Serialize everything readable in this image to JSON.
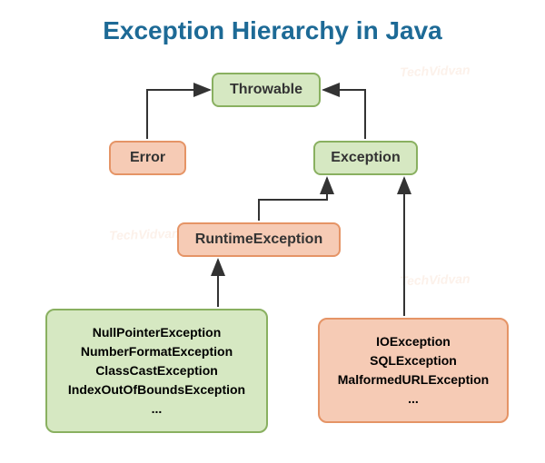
{
  "chart_data": {
    "type": "diagram",
    "title": "Exception Hierarchy in Java",
    "nodes": [
      {
        "id": "throwable",
        "label": "Throwable"
      },
      {
        "id": "error",
        "label": "Error",
        "parent": "throwable"
      },
      {
        "id": "exception",
        "label": "Exception",
        "parent": "throwable"
      },
      {
        "id": "runtime",
        "label": "RuntimeException",
        "parent": "exception"
      },
      {
        "id": "unchecked_list",
        "parent": "runtime",
        "items": [
          "NullPointerException",
          "NumberFormatException",
          "ClassCastException",
          "IndexOutOfBoundsException",
          "..."
        ]
      },
      {
        "id": "checked_list",
        "parent": "exception",
        "items": [
          "IOException",
          "SQLException",
          "MalformedURLException",
          "..."
        ]
      }
    ]
  },
  "title": "Exception Hierarchy in Java",
  "throwable": "Throwable",
  "error": "Error",
  "exception": "Exception",
  "runtime": "RuntimeException",
  "unchk": {
    "l1": "NullPointerException",
    "l2": "NumberFormatException",
    "l3": "ClassCastException",
    "l4": "IndexOutOfBoundsException",
    "l5": "..."
  },
  "chk": {
    "l1": "IOException",
    "l2": "SQLException",
    "l3": "MalformedURLException",
    "l4": "..."
  },
  "watermark": "TechVidvan"
}
